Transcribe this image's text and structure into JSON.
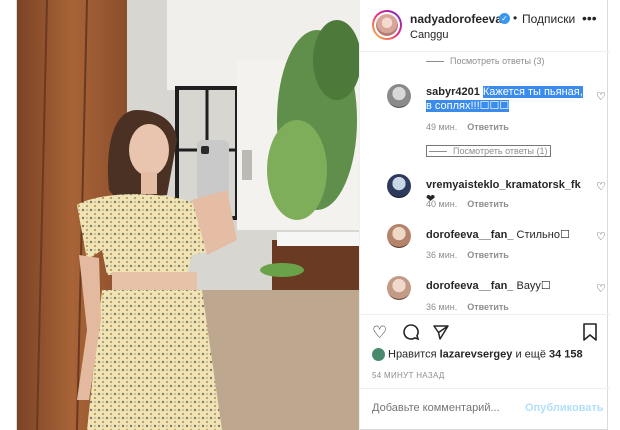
{
  "header": {
    "username": "nadyadorofeeva",
    "follow_label": "Подписки",
    "location": "Canggu",
    "verified_icon": "verified-badge-icon",
    "more_icon": "more-options-icon"
  },
  "comments": {
    "view_replies_top": "Посмотреть ответы (3)",
    "items": [
      {
        "username": "sabyr4201",
        "text": "Кажется ты пьяная, в соплях!!!☐☐☐",
        "time": "49 мин.",
        "reply_label": "Ответить",
        "replies_label": "Посмотреть ответы (1)"
      },
      {
        "username": "vremyaisteklo_kramatorsk_fk",
        "text": "❤",
        "time": "40 мин.",
        "reply_label": "Ответить"
      },
      {
        "username": "dorofeeva__fan_",
        "text": "Стильно☐",
        "time": "36 мин.",
        "reply_label": "Ответить"
      },
      {
        "username": "dorofeeva__fan_",
        "text": "Вауу☐",
        "time": "36 мин.",
        "reply_label": "Ответить"
      }
    ]
  },
  "likes": {
    "prefix": "Нравится",
    "user": "lazarevsergey",
    "middle": "и ещё",
    "count": "34 158"
  },
  "timestamp": "54 МИНУТ НАЗАД",
  "add_comment": {
    "placeholder": "Добавьте комментарий...",
    "publish_label": "Опубликовать"
  }
}
